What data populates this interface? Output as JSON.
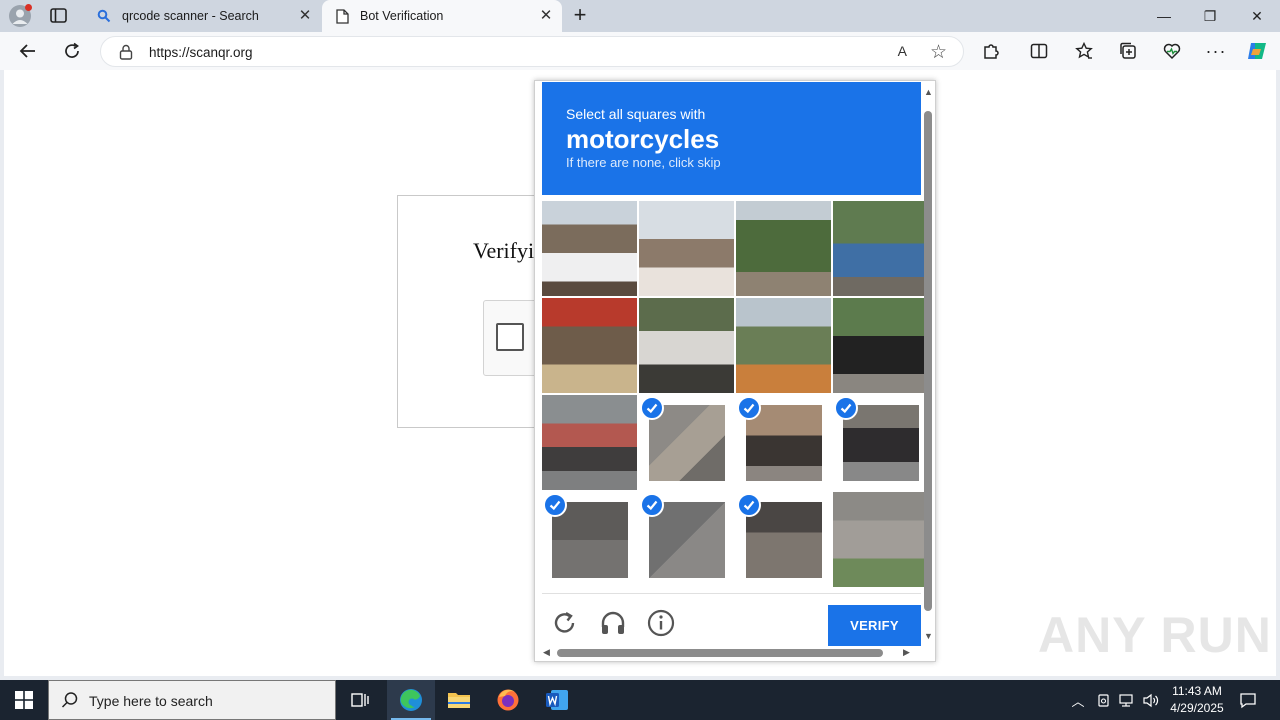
{
  "browser": {
    "tabs": [
      {
        "title": "qrcode scanner - Search"
      },
      {
        "title": "Bot Verification"
      }
    ],
    "new_tab": "+",
    "address_url": "https://scanqr.org",
    "read_aloud": "A",
    "window": {
      "minimize": "—",
      "restore": "❐",
      "close": "✕"
    }
  },
  "page": {
    "verify_title": "Verifyi"
  },
  "challenge": {
    "instruction": "Select all squares with",
    "object": "motorcycles",
    "skip_hint": "If there are none, click skip",
    "verify_label": "VERIFY",
    "tiles": [
      {
        "selected": false
      },
      {
        "selected": false
      },
      {
        "selected": false
      },
      {
        "selected": false
      },
      {
        "selected": false
      },
      {
        "selected": false
      },
      {
        "selected": false
      },
      {
        "selected": false
      },
      {
        "selected": false
      },
      {
        "selected": true
      },
      {
        "selected": true
      },
      {
        "selected": true
      },
      {
        "selected": true
      },
      {
        "selected": true
      },
      {
        "selected": true
      },
      {
        "selected": false
      }
    ],
    "accent_color": "#1a73e8"
  },
  "watermark": "ANY RUN",
  "taskbar": {
    "search_placeholder": "Type here to search",
    "time": "11:43 AM",
    "date": "4/29/2025"
  }
}
